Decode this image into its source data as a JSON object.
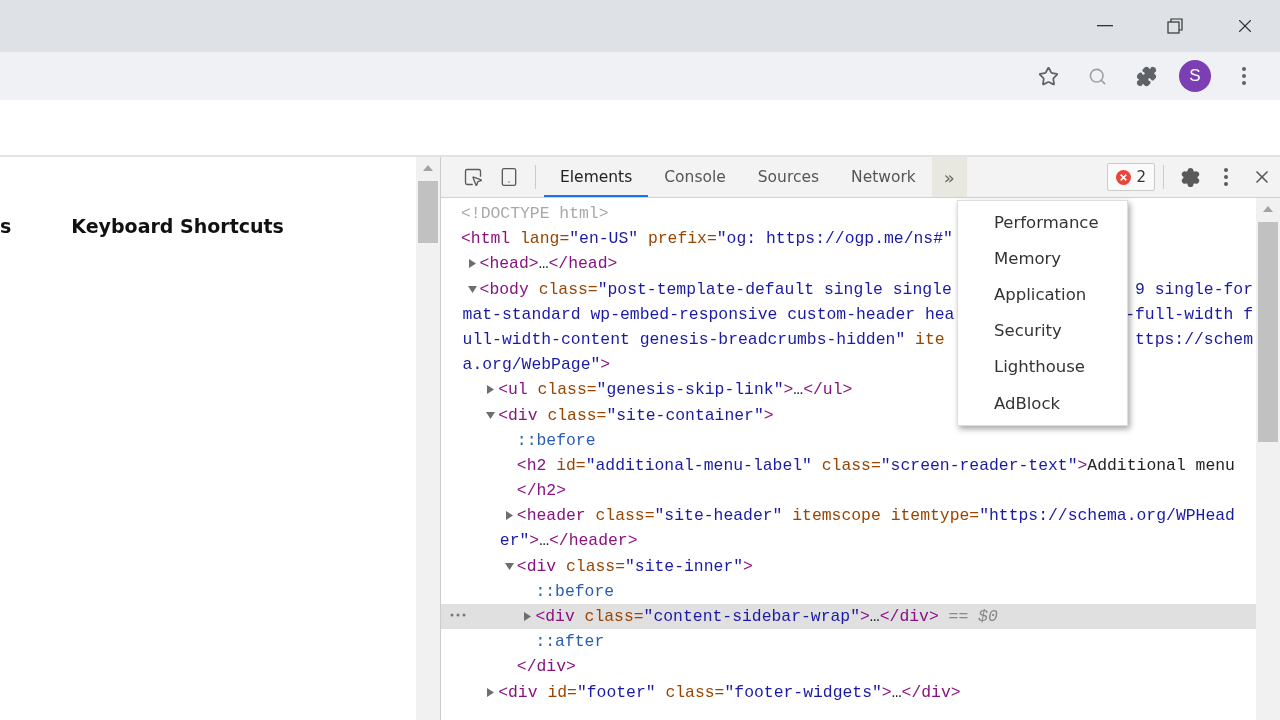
{
  "browser": {
    "avatar_letter": "S"
  },
  "page": {
    "texts": [
      "s",
      "Keyboard Shortcuts"
    ]
  },
  "devtools": {
    "tabs": [
      {
        "label": "Elements",
        "selected": true
      },
      {
        "label": "Console",
        "selected": false
      },
      {
        "label": "Sources",
        "selected": false
      },
      {
        "label": "Network",
        "selected": false
      }
    ],
    "more_tabs": "»",
    "error_count": "2",
    "overflow_menu": {
      "items": [
        "Performance",
        "Memory",
        "Application",
        "Security",
        "Lighthouse",
        "AdBlock"
      ]
    },
    "dom_tree": [
      {
        "text": "<!DOCTYPE html>",
        "selected": false
      },
      {
        "text": "<html lang=\"en-US\" prefix=\"og: https://ogp.me/ns#\"",
        "selected": false,
        "children": [
          {
            "text": "<head>…</head>",
            "expanded": false,
            "selected": false
          },
          {
            "text": "<body class=\"post-template-default single single",
            "after": "9 single-for",
            "expanded": true,
            "selected": false,
            "lines": [
              {
                "text": "mat-standard wp-embed-responsive custom-header hea",
                "after": "-full-width f"
              },
              {
                "text": "ull-width-content genesis-breadcrumbs-hidden\" ite",
                "after": "ttps://schem"
              },
              {
                "text": "a.org/WebPage\">"
              }
            ],
            "children": [
              {
                "text": "<ul class=\"genesis-skip-link\">…</ul>",
                "expanded": false,
                "selected": false
              },
              {
                "text": "<div class=\"site-container\">",
                "expanded": true,
                "selected": false,
                "children": [
                  {
                    "text": "::before",
                    "selected": false
                  },
                  {
                    "text": "<h2 id=\"additional-menu-label\" class=\"screen-reader-text\">Additional menu",
                    "selected": false,
                    "lines": [
                      {
                        "text": "</h2>"
                      }
                    ]
                  },
                  {
                    "text": "<header class=\"site-header\" itemscope itemtype=\"https://schema.org/WPHead",
                    "expanded": false,
                    "selected": false,
                    "lines": [
                      {
                        "text": "er\">…</header>"
                      }
                    ]
                  },
                  {
                    "text": "<div class=\"site-inner\">",
                    "expanded": true,
                    "selected": false,
                    "closing": "</div>",
                    "children": [
                      {
                        "text": "::before",
                        "selected": false
                      },
                      {
                        "text": "<div class=\"content-sidebar-wrap\">…</div>",
                        "expanded": false,
                        "selected": true,
                        "marker": "== $0"
                      },
                      {
                        "text": "::after",
                        "selected": false
                      }
                    ]
                  }
                ]
              },
              {
                "text": "<div id=\"footer\" class=\"footer-widgets\">…</div>",
                "expanded": false,
                "selected": false
              }
            ]
          }
        ]
      }
    ]
  }
}
